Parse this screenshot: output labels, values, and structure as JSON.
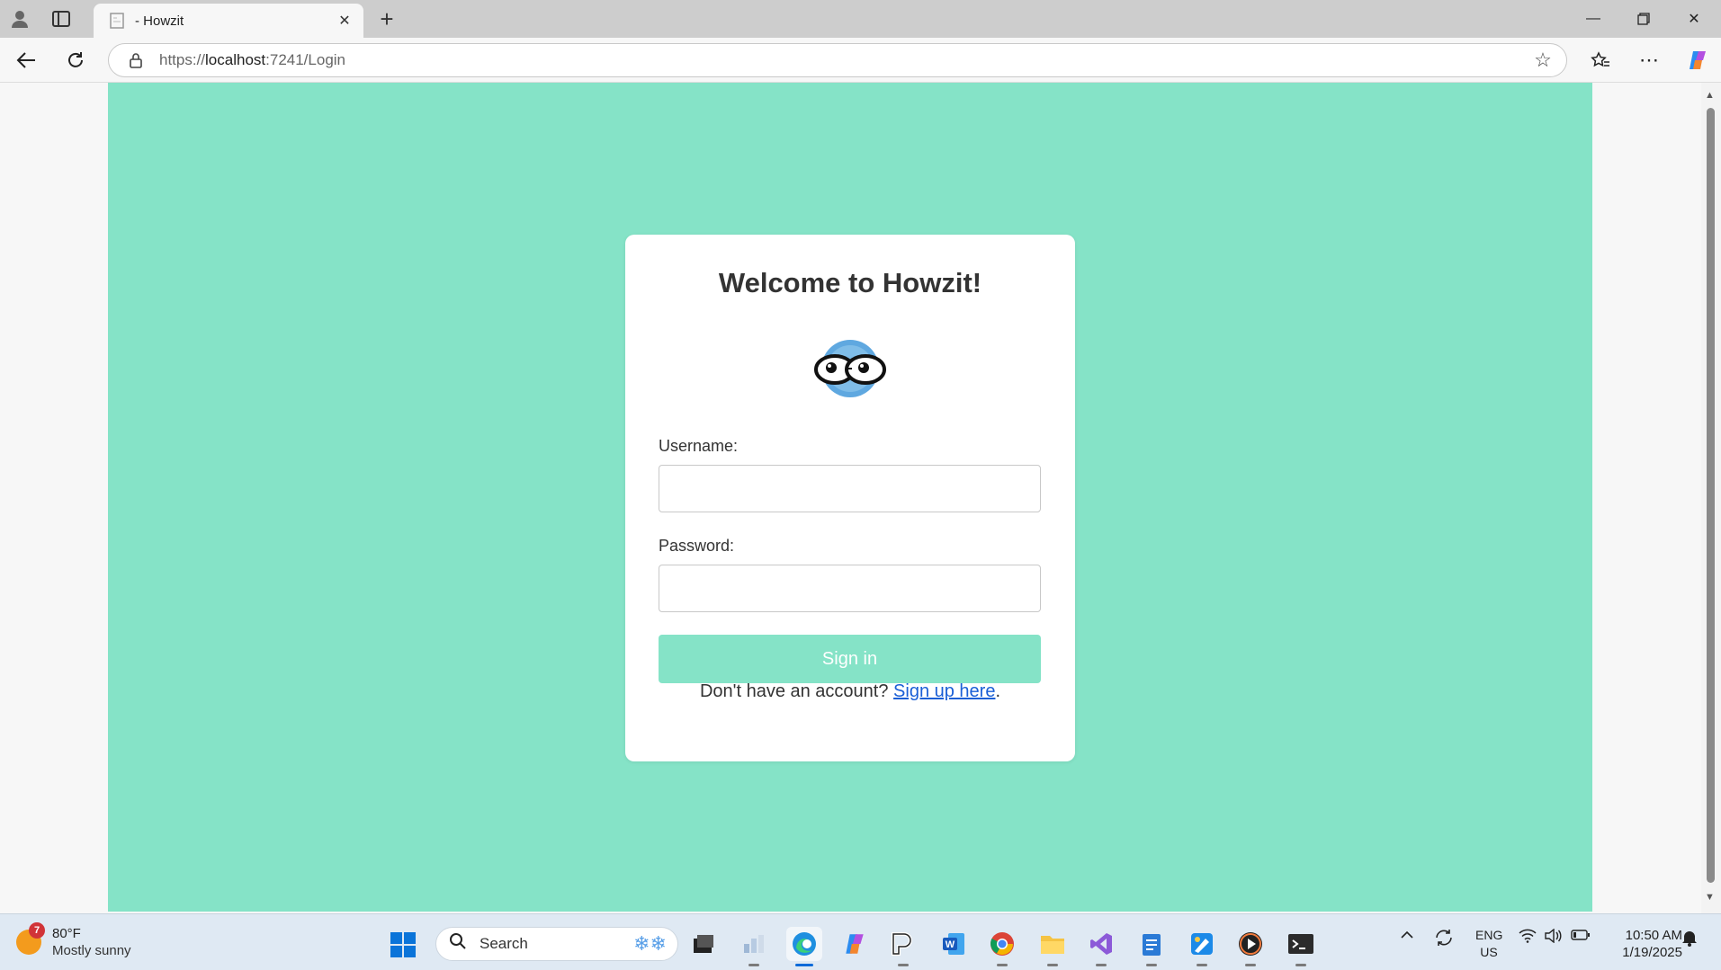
{
  "browser": {
    "tab_title": "- Howzit",
    "url_prefix": "https://",
    "url_host": "localhost",
    "url_path": ":7241/Login"
  },
  "login": {
    "heading": "Welcome to Howzit!",
    "username_label": "Username:",
    "password_label": "Password:",
    "username_value": "",
    "password_value": "",
    "signin_label": "Sign in",
    "signup_prompt": "Don't have an account?",
    "signup_link": "Sign up here",
    "signup_suffix": "."
  },
  "colors": {
    "page_background": "#85e3c7",
    "link": "#1a5fd6",
    "card": "#ffffff"
  },
  "taskbar": {
    "weather_badge": "7",
    "temperature": "80°F",
    "condition": "Mostly sunny",
    "search_placeholder": "Search",
    "lang_top": "ENG",
    "lang_bottom": "US",
    "time": "10:50 AM",
    "date": "1/19/2025",
    "apps": [
      "task-view",
      "widgets",
      "edge",
      "copilot",
      "pycharm",
      "word",
      "chrome",
      "file-explorer",
      "visual-studio",
      "notepad",
      "paint",
      "media-player",
      "terminal"
    ]
  }
}
